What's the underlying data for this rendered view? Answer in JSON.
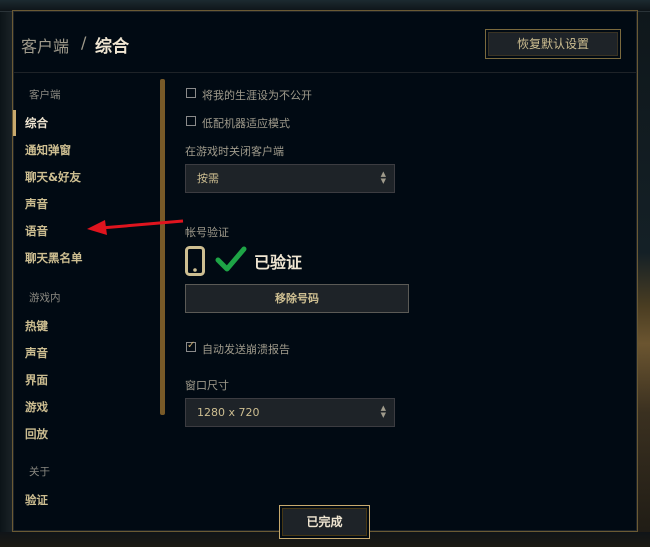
{
  "breadcrumb": {
    "root": "客户端",
    "separator": "/",
    "current": "综合"
  },
  "header": {
    "reset_label": "恢复默认设置"
  },
  "nav": {
    "sections": [
      {
        "label": "客户端",
        "items": [
          "综合",
          "通知弹窗",
          "聊天&好友",
          "声音",
          "语音",
          "聊天黑名单"
        ]
      },
      {
        "label": "游戏内",
        "items": [
          "热键",
          "声音",
          "界面",
          "游戏",
          "回放"
        ]
      },
      {
        "label": "关于",
        "items": [
          "验证"
        ]
      }
    ],
    "active_item": "综合"
  },
  "settings": {
    "private_career": {
      "label": "将我的生涯设为不公开",
      "checked": false
    },
    "low_spec_mode": {
      "label": "低配机器适应模式",
      "checked": false
    },
    "close_client_label": "在游戏时关闭客户端",
    "close_client_value": "按需",
    "account_verify_label": "帐号验证",
    "verified_text": "已验证",
    "remove_number_label": "移除号码",
    "auto_crash_report": {
      "label": "自动发送崩溃报告",
      "checked": true
    },
    "window_size_label": "窗口尺寸",
    "window_size_value": "1280 x 720"
  },
  "footer": {
    "done_label": "已完成"
  },
  "icons": {
    "phone": "phone-icon",
    "verified": "checkmark-icon",
    "dropdown": "chevron-updown-icon",
    "annotation": "red-arrow-icon"
  },
  "colors": {
    "gold": "#c8aa6e",
    "gold_text": "#cdbe91",
    "panel_bg": "#010a13",
    "verified_green": "#1ea446",
    "arrow_red": "#e0141e"
  }
}
